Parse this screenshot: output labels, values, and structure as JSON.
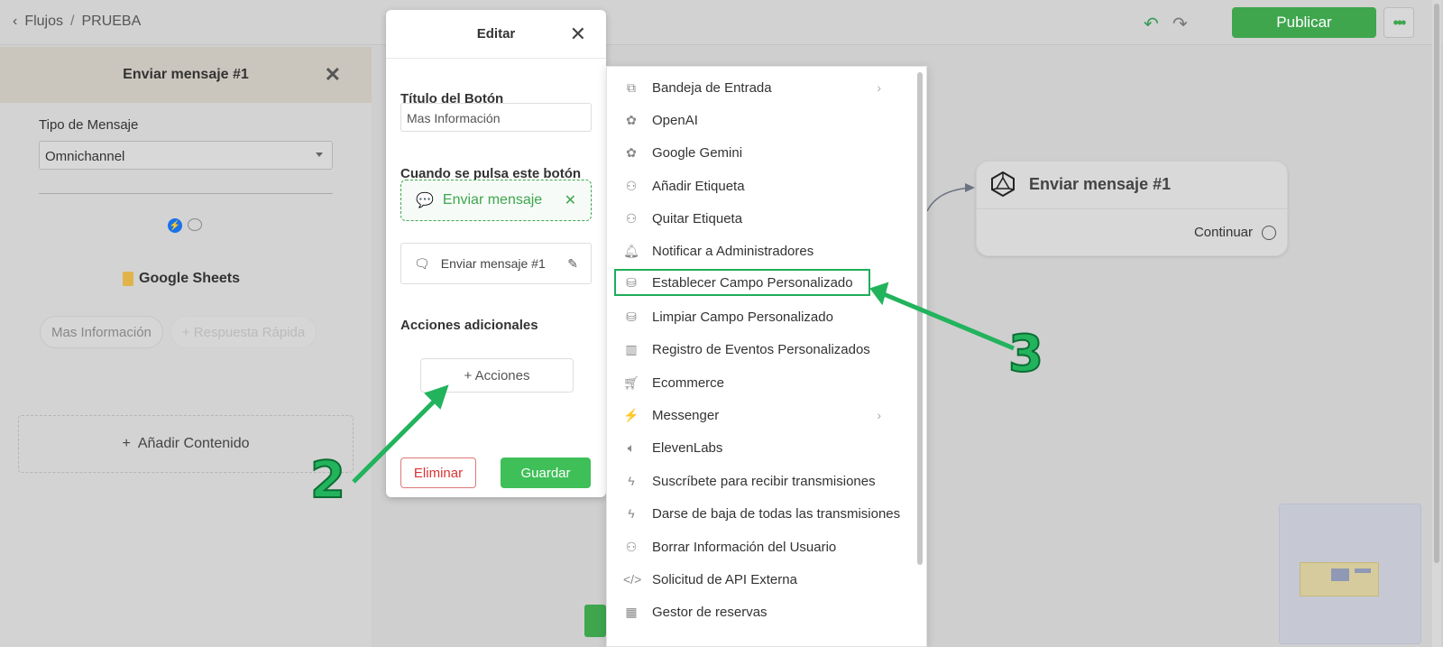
{
  "topbar": {
    "breadcrumb_root": "Flujos",
    "breadcrumb_sep": "/",
    "breadcrumb_current": "PRUEBA",
    "publish_label": "Publicar"
  },
  "left_panel": {
    "title": "Enviar mensaje #1",
    "message_type_label": "Tipo de Mensaje",
    "message_type_value": "Omnichannel",
    "integration_label": "Google Sheets",
    "chips": [
      "Mas Información",
      "+ Respuesta Rápida"
    ],
    "add_content_label": "Añadir Contenido"
  },
  "edit_modal": {
    "title": "Editar",
    "button_title_label": "Título del Botón",
    "button_title_value": "Mas Información",
    "on_press_label": "Cuando se pulsa este botón",
    "action_label": "Enviar mensaje",
    "target_label": "Enviar mensaje #1",
    "additional_actions_label": "Acciones adicionales",
    "add_actions_label": "+ Acciones",
    "delete_label": "Eliminar",
    "save_label": "Guardar"
  },
  "actions_menu": {
    "items": [
      {
        "label": "Bandeja de Entrada",
        "icon": "inbox-chat-icon",
        "submenu": true
      },
      {
        "label": "OpenAI",
        "icon": "openai-icon"
      },
      {
        "label": "Google Gemini",
        "icon": "gemini-icon"
      },
      {
        "label": "Añadir Etiqueta",
        "icon": "user-tag-icon"
      },
      {
        "label": "Quitar Etiqueta",
        "icon": "user-tag-icon"
      },
      {
        "label": "Notificar a Administradores",
        "icon": "bell-icon"
      },
      {
        "label": "Establecer Campo Personalizado",
        "icon": "database-icon",
        "highlighted": true
      },
      {
        "label": "Limpiar Campo Personalizado",
        "icon": "database-icon"
      },
      {
        "label": "Registro de Eventos Personalizados",
        "icon": "bar-chart-icon"
      },
      {
        "label": "Ecommerce",
        "icon": "cart-icon"
      },
      {
        "label": "Messenger",
        "icon": "messenger-icon",
        "submenu": true
      },
      {
        "label": "ElevenLabs",
        "icon": "speaker-icon"
      },
      {
        "label": "Suscríbete para recibir transmisiones",
        "icon": "bolt-icon"
      },
      {
        "label": "Darse de baja de todas las transmisiones",
        "icon": "bolt-icon"
      },
      {
        "label": "Borrar Información del Usuario",
        "icon": "user-remove-icon"
      },
      {
        "label": "Solicitud de API Externa",
        "icon": "code-icon"
      },
      {
        "label": "Gestor de reservas",
        "icon": "calendar-icon"
      }
    ]
  },
  "canvas_node": {
    "title": "Enviar mensaje #1",
    "output_label": "Continuar"
  },
  "annotations": {
    "step_2": "2",
    "step_3": "3"
  },
  "colors": {
    "accent_green": "#3fa64e",
    "annotation_green": "#22b35d",
    "danger_red": "#d33"
  }
}
